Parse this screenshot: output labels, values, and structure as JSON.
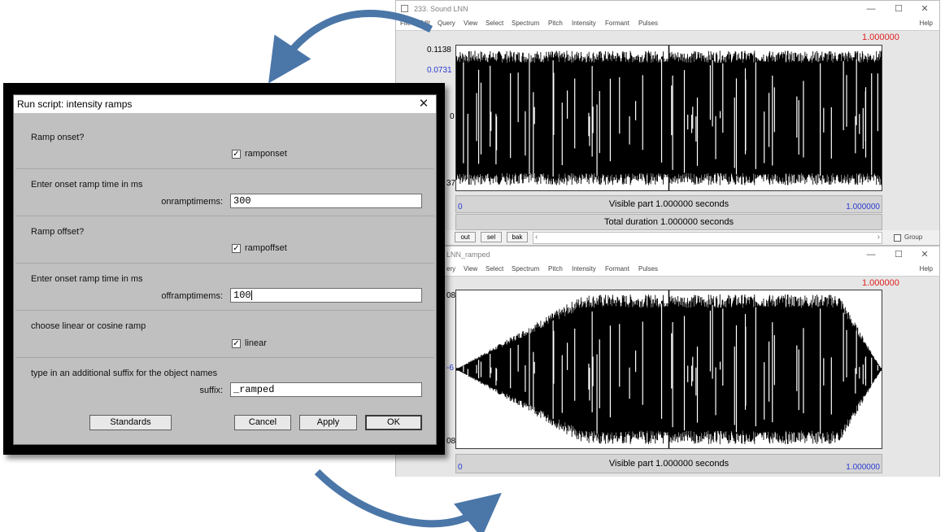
{
  "window_top": {
    "title": "233. Sound LNN",
    "controls": {
      "minimize": "—",
      "maximize": "☐",
      "close": "✕"
    },
    "menu": [
      "File",
      "Edit",
      "Query",
      "View",
      "Select",
      "Spectrum",
      "Pitch",
      "Intensity",
      "Formant",
      "Pulses",
      "Help"
    ],
    "amp_top": "0.1138",
    "amp_cursor": "0.0731",
    "amp_zero": "0",
    "amp_bottom": "37",
    "cursor_time": "1.000000",
    "visible_start": "0",
    "visible_label": "Visible part 1.000000 seconds",
    "visible_end": "1.000000",
    "total_label": "Total duration 1.000000 seconds",
    "toolbar": [
      "out",
      "sel",
      "bak"
    ],
    "scroll_left": "‹",
    "scroll_right": "›",
    "group_label": "Group"
  },
  "window_bottom": {
    "title": "LNN_ramped",
    "controls": {
      "minimize": "—",
      "maximize": "☐",
      "close": "✕"
    },
    "menu": [
      "ery",
      "View",
      "Select",
      "Spectrum",
      "Pitch",
      "Intensity",
      "Formant",
      "Pulses",
      "Help"
    ],
    "amp_top": "08",
    "amp_mid": "-6",
    "amp_bottom": "08",
    "cursor_time": "1.000000",
    "visible_start": "0",
    "visible_label": "Visible part 1.000000 seconds",
    "visible_end": "1.000000"
  },
  "dialog": {
    "title": "Run script: intensity ramps",
    "close": "✕",
    "q1": "Ramp onset?",
    "cb1": {
      "label": "ramponset",
      "checked": "✓"
    },
    "q2": "Enter onset ramp time in ms",
    "f1": {
      "label": "onramptimems:",
      "value": "300"
    },
    "q3": "Ramp offset?",
    "cb2": {
      "label": "rampoffset",
      "checked": "✓"
    },
    "q4": "Enter onset ramp time in ms",
    "f2": {
      "label": "offramptimems:",
      "value": "100"
    },
    "q5": "choose linear or cosine ramp",
    "cb3": {
      "label": "linear",
      "checked": "✓"
    },
    "q6": "type in an additional suffix for the object names",
    "f3": {
      "label": "suffix:",
      "value": "_ramped"
    },
    "buttons": {
      "standards": "Standards",
      "cancel": "Cancel",
      "apply": "Apply",
      "ok": "OK"
    }
  },
  "colors": {
    "arrow": "#4b76a8",
    "cursor_red": "#e02020",
    "axis_blue": "#2a3bd1"
  },
  "waveforms": {
    "top_envelope": [
      1,
      1,
      1,
      1
    ],
    "bottom_ramp_on_ms": 300,
    "bottom_ramp_off_ms": 100
  }
}
